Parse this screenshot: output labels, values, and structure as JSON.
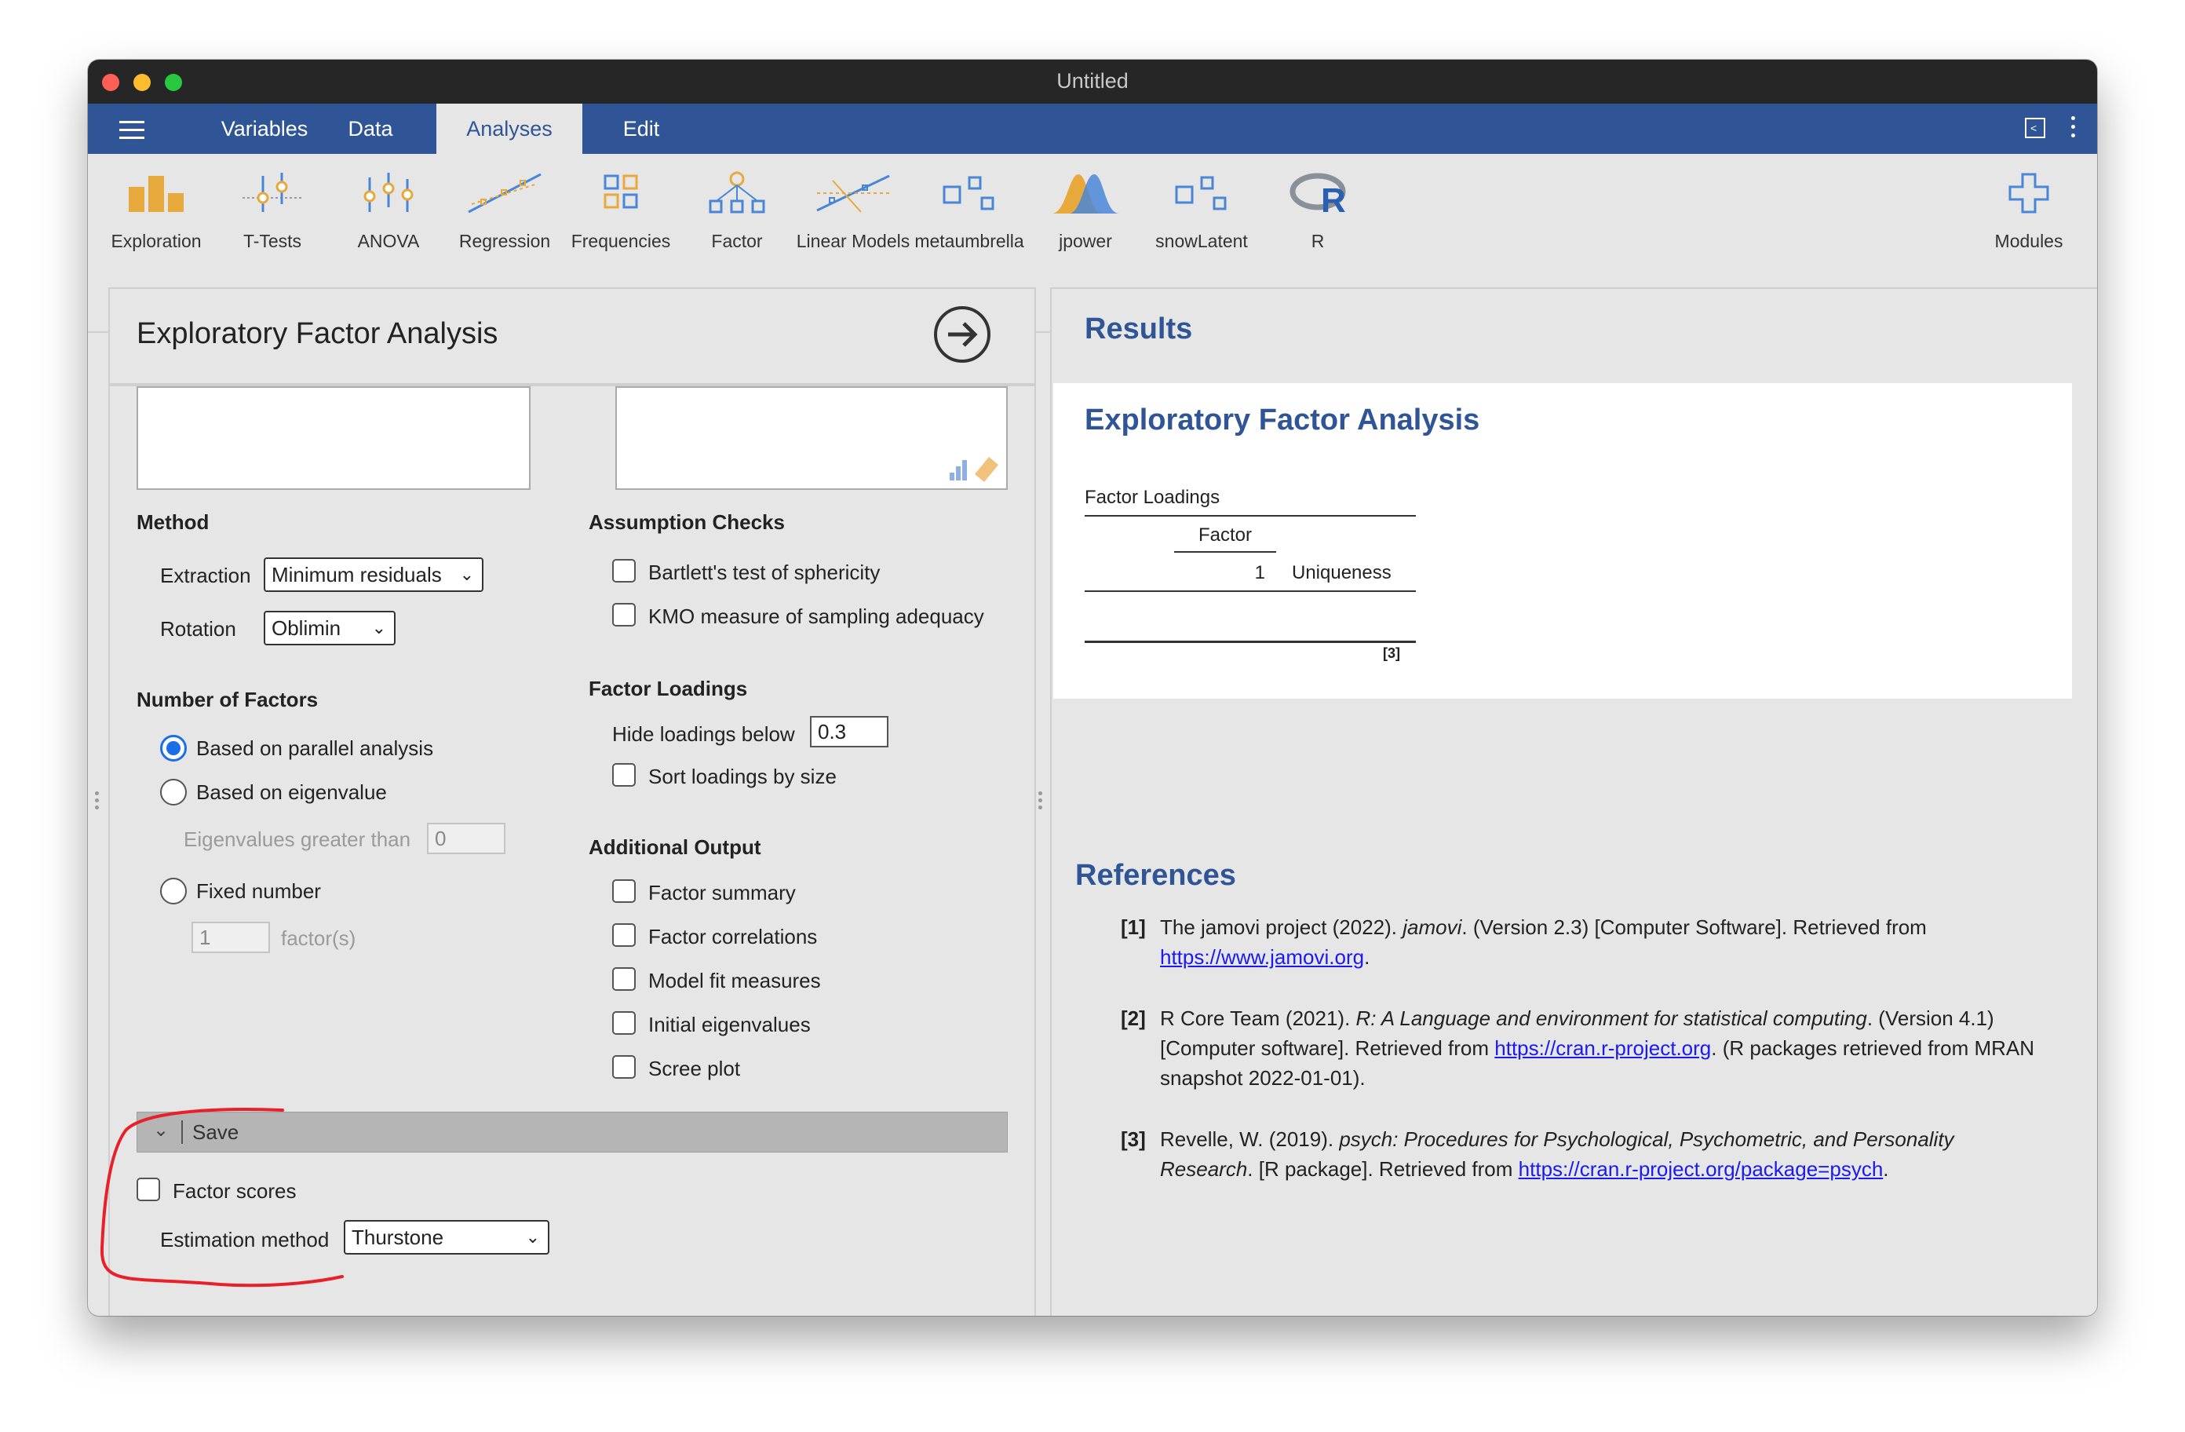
{
  "window": {
    "title": "Untitled"
  },
  "tabs": [
    "Variables",
    "Data",
    "Analyses",
    "Edit"
  ],
  "ribbon": {
    "items": [
      "Exploration",
      "T-Tests",
      "ANOVA",
      "Regression",
      "Frequencies",
      "Factor",
      "Linear Models",
      "metaumbrella",
      "jpower",
      "snowLatent",
      "R"
    ],
    "modules": "Modules"
  },
  "analysis": {
    "title": "Exploratory Factor Analysis",
    "method": {
      "heading": "Method",
      "extraction_label": "Extraction",
      "extraction_value": "Minimum residuals",
      "rotation_label": "Rotation",
      "rotation_value": "Oblimin"
    },
    "factors": {
      "heading": "Number of Factors",
      "parallel": "Based on parallel analysis",
      "eigenvalue": "Based on eigenvalue",
      "eigen_label": "Eigenvalues greater than",
      "eigen_value": "0",
      "fixed": "Fixed number",
      "fixed_value": "1",
      "fixed_unit": "factor(s)"
    },
    "assumptions": {
      "heading": "Assumption Checks",
      "bartlett": "Bartlett's test of sphericity",
      "kmo": "KMO measure of sampling adequacy"
    },
    "loadings": {
      "heading": "Factor Loadings",
      "hide_label": "Hide loadings below",
      "hide_value": "0.3",
      "sort": "Sort loadings by size"
    },
    "additional": {
      "heading": "Additional Output",
      "items": [
        "Factor summary",
        "Factor correlations",
        "Model fit measures",
        "Initial eigenvalues",
        "Scree plot"
      ]
    },
    "save": {
      "label": "Save",
      "factor_scores": "Factor scores",
      "estimation_label": "Estimation method",
      "estimation_value": "Thurstone"
    }
  },
  "results": {
    "heading": "Results",
    "title": "Exploratory Factor Analysis",
    "table": {
      "caption": "Factor Loadings",
      "group_header": "Factor",
      "col1": "1",
      "col2": "Uniqueness",
      "footnote": "[3]"
    }
  },
  "references": {
    "heading": "References",
    "items": [
      {
        "num": "[1]",
        "pre": "The jamovi project (2022). ",
        "ital": "jamovi",
        "post": ". (Version 2.3) [Computer Software]. Retrieved from",
        "link": "https://www.jamovi.org",
        "tail": "."
      },
      {
        "num": "[2]",
        "pre": "R Core Team (2021). ",
        "ital": "R: A Language and environment for statistical computing",
        "post": ". (Version 4.1) [Computer software]. Retrieved from ",
        "link": "https://cran.r-project.org",
        "tail": ". (R packages retrieved from MRAN snapshot 2022-01-01)."
      },
      {
        "num": "[3]",
        "pre": "Revelle, W. (2019). ",
        "ital": "psych: Procedures for Psychological, Psychometric, and Personality Research",
        "post": ". [R package]. Retrieved from ",
        "link": "https://cran.r-project.org/package=psych",
        "tail": "."
      }
    ]
  },
  "colors": {
    "tabbar": "#2f5597",
    "accent": "#1a6ee8",
    "annotation": "#e8202a"
  }
}
